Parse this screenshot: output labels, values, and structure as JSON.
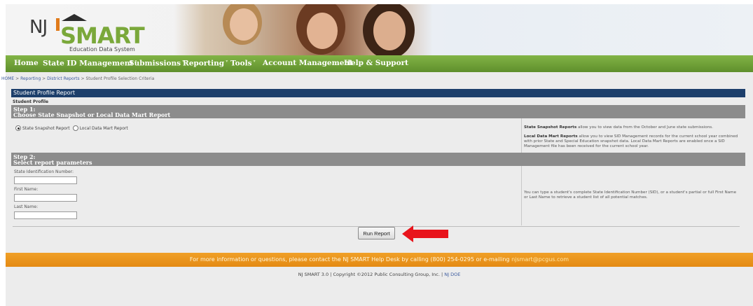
{
  "logo": {
    "nj": "NJ",
    "smart": "SMART",
    "subtitle": "Education Data System"
  },
  "nav": {
    "items": [
      {
        "label": "Home",
        "has_menu": false
      },
      {
        "label": "State ID Management",
        "has_menu": true
      },
      {
        "label": "Submissions",
        "has_menu": true
      },
      {
        "label": "Reporting",
        "has_menu": true
      },
      {
        "label": "Tools",
        "has_menu": true
      },
      {
        "label": "Account Management",
        "has_menu": false
      },
      {
        "label": "Help & Support",
        "has_menu": false
      }
    ]
  },
  "breadcrumb": {
    "home": "HOME",
    "reporting": "Reporting",
    "district_reports": "District Reports",
    "current": "Student Profile Selection Criteria",
    "separator": ">"
  },
  "panel": {
    "title": "Student Profile Report",
    "subtitle": "Student Profile"
  },
  "step1": {
    "heading": "Step 1:",
    "title": "Choose State Snapshot or Local Data Mart Report",
    "options": [
      {
        "label": "State Snapshot Report",
        "selected": true
      },
      {
        "label": "Local Data Mart Report",
        "selected": false
      }
    ],
    "hint_snapshot_bold": "State Snapshot Reports",
    "hint_snapshot": "allow you to view data from the October and June state submissions.",
    "hint_local_bold": "Local Data Mart Reports",
    "hint_local": "allow you to view SID Management records for the current school year combined with prior State and Special Education snapshot data. Local Data Mart Reports are enabled once a SID Management file has been received for the current school year."
  },
  "step2": {
    "heading": "Step 2:",
    "title": "Select report parameters",
    "fields": [
      {
        "label": "State Identification Number:",
        "value": ""
      },
      {
        "label": "First Name:",
        "value": ""
      },
      {
        "label": "Last Name:",
        "value": ""
      }
    ],
    "hint": "You can type a student's complete State Identification Number (SID), or a student's partial or full First Name or Last Name to retrieve a student list of all potential matches."
  },
  "actions": {
    "run_report": "Run Report"
  },
  "footer": {
    "text": "For more information or questions, please contact the NJ SMART Help Desk by calling (800) 254-0295 or e-mailing",
    "email": "njsmart@pcgus.com"
  },
  "copyright": {
    "text": "NJ SMART 3.0 | Copyright ©2012 Public Consulting Group, Inc. |",
    "link": "NJ DOE"
  },
  "colors": {
    "nav_green": "#6fa23a",
    "panel_navy": "#1d3f6b",
    "step_gray": "#8c8c8c",
    "footer_orange": "#eb951e",
    "arrow_red": "#e8141c"
  }
}
